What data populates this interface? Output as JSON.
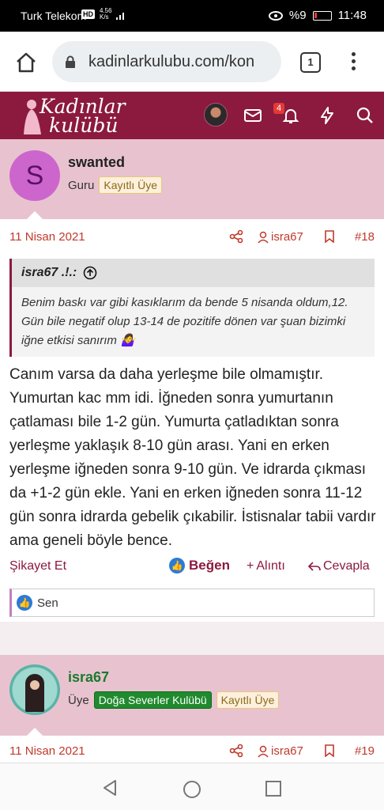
{
  "status_bar": {
    "carrier": "Turk Telekom",
    "hd": "HD",
    "net_speed": "4.56",
    "net_unit": "K/s",
    "battery": "%9",
    "time": "11:48"
  },
  "browser": {
    "url": "kadinlarkulubu.com/kon",
    "tab_count": "1"
  },
  "site": {
    "logo_line1": "Kadınlar",
    "logo_line2": "kulübü",
    "notification_count": "4"
  },
  "post1": {
    "username": "swanted",
    "avatar_letter": "S",
    "user_title": "Guru",
    "badge": "Kayıtlı Üye",
    "date": "11 Nisan 2021",
    "author_link": "isra67",
    "post_number": "#18",
    "quote": {
      "author": "isra67 .!.:",
      "text": "Benim baskı var gibi kasıklarım da bende 5 nisanda oldum,12. Gün bile negatif olup 13-14 de pozitife dönen var şuan bizimki iğne etkisi sanırım 🤷‍♀️"
    },
    "body": "Canım varsa da daha yerleşme bile olmamıştır. Yumurtan kac mm idi. İğneden sonra yumurtanın çatlaması bile 1-2 gün. Yumurta çatladıktan sonra yerleşme yaklaşık 8-10 gün arası. Yani en erken yerleşme iğneden sonra 9-10 gün. Ve idrarda çıkması da +1-2 gün ekle. Yani en erken iğneden sonra 11-12 gün sonra idrarda gebelik çıkabilir. İstisnalar tabii vardır ama geneli böyle bence.",
    "actions": {
      "report": "Şikayet Et",
      "like": "Beğen",
      "quote": "Alıntı",
      "reply": "Cevapla"
    },
    "likes_text": "Sen"
  },
  "post2": {
    "username": "isra67",
    "user_title": "Üye",
    "badge_group": "Doğa Severler Kulübü",
    "badge": "Kayıtlı Üye",
    "date": "11 Nisan 2021",
    "author_link": "isra67",
    "post_number": "#19"
  },
  "colors": {
    "brand": "#8b1a3e",
    "userbar": "#e8c3cf",
    "link_red": "#c0392b"
  },
  "icons": [
    "home-icon",
    "lock-icon",
    "menu-icon",
    "mail-icon",
    "bell-icon",
    "bolt-icon",
    "search-icon",
    "share-icon",
    "user-icon",
    "bookmark-icon",
    "arrow-up-circle-icon",
    "like-icon",
    "plus-icon",
    "reply-icon",
    "back-icon",
    "circle-home-icon",
    "square-recent-icon"
  ]
}
